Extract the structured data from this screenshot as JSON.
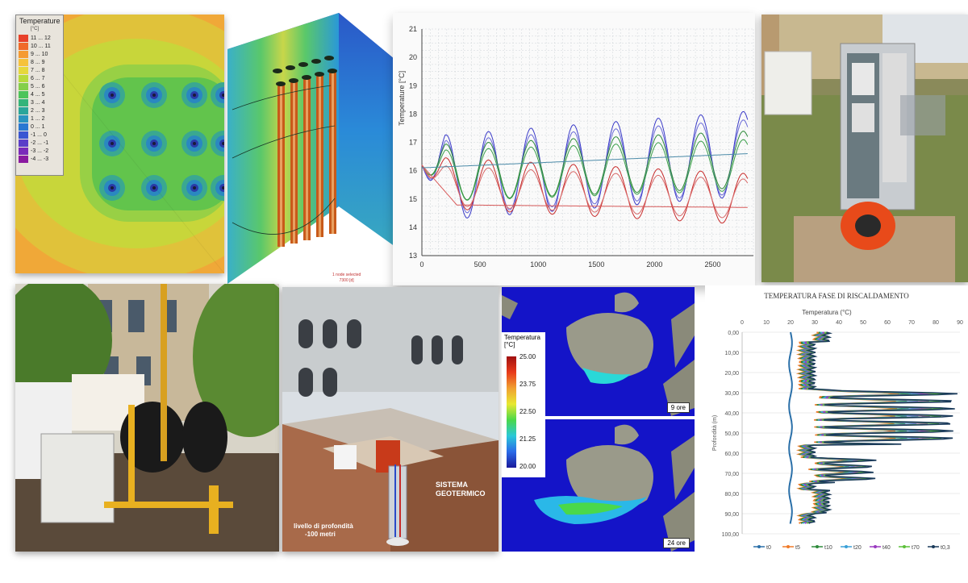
{
  "thermal_map": {
    "legend_title": "Temperature",
    "legend_unit": "[°C]",
    "legend_rows": [
      {
        "label": "11 ... 12",
        "color": "#e8412a"
      },
      {
        "label": "10 ... 11",
        "color": "#f06a2a"
      },
      {
        "label": "9 ... 10",
        "color": "#f59a32"
      },
      {
        "label": "8 ... 9",
        "color": "#f6c23c"
      },
      {
        "label": "7 ... 8",
        "color": "#e6d83c"
      },
      {
        "label": "6 ... 7",
        "color": "#b8da3c"
      },
      {
        "label": "5 ... 6",
        "color": "#84cf4a"
      },
      {
        "label": "4 ... 5",
        "color": "#4cc45a"
      },
      {
        "label": "3 ... 4",
        "color": "#34b47a"
      },
      {
        "label": "2 ... 3",
        "color": "#2aa69a"
      },
      {
        "label": "1 ... 2",
        "color": "#2a94c0"
      },
      {
        "label": "0 ... 1",
        "color": "#2a78d2"
      },
      {
        "label": "-1 ... 0",
        "color": "#3a56d2"
      },
      {
        "label": "-2 ... -1",
        "color": "#5a3ec8"
      },
      {
        "label": "-3 ... -2",
        "color": "#7a2aba"
      },
      {
        "label": "-4 ... -3",
        "color": "#8a1aa0"
      }
    ]
  },
  "model3d": {
    "status_line1": "1 node selected",
    "status_line2": "7300 [d]"
  },
  "temp_chart": {
    "ylabel": "Temperature [°C]",
    "yticks": [
      "21",
      "20",
      "19",
      "18",
      "17",
      "16",
      "15",
      "14",
      "13"
    ],
    "xticks": [
      "0",
      "500",
      "1000",
      "1500",
      "2000",
      "2500"
    ]
  },
  "simulation": {
    "legend_title": "Temperatura",
    "legend_unit": "[°C]",
    "legend_values": [
      "25.00",
      "23.75",
      "22.50",
      "21.25",
      "20.00"
    ],
    "label_top": "9 ore",
    "label_bottom": "24 ore"
  },
  "rendering": {
    "label_system_1": "SISTEMA",
    "label_system_2": "GEOTERMICO",
    "label_depth_1": "livello di profondità",
    "label_depth_2": "-100 metri"
  },
  "profile_chart": {
    "title": "TEMPERATURA FASE DI RISCALDAMENTO",
    "xlabel": "Temperatura (°C)",
    "ylabel": "Profondità (m)",
    "xticks": [
      "0",
      "10",
      "20",
      "30",
      "40",
      "50",
      "60",
      "70",
      "80",
      "90"
    ],
    "yticks": [
      "0,00",
      "10,00",
      "20,00",
      "30,00",
      "40,00",
      "50,00",
      "60,00",
      "70,00",
      "80,00",
      "90,00",
      "100,00"
    ],
    "legend": [
      {
        "label": "t0",
        "color": "#2a6fa8"
      },
      {
        "label": "t5",
        "color": "#f07a28"
      },
      {
        "label": "t10",
        "color": "#2e8a3a"
      },
      {
        "label": "t20",
        "color": "#3aa0d8"
      },
      {
        "label": "t40",
        "color": "#9a3ac0"
      },
      {
        "label": "t70",
        "color": "#5cc03a"
      },
      {
        "label": "t0,3",
        "color": "#1a3a5a"
      }
    ]
  },
  "colors": {
    "sim_sea": "#1414c8",
    "chart_bg": "#ffffff"
  }
}
